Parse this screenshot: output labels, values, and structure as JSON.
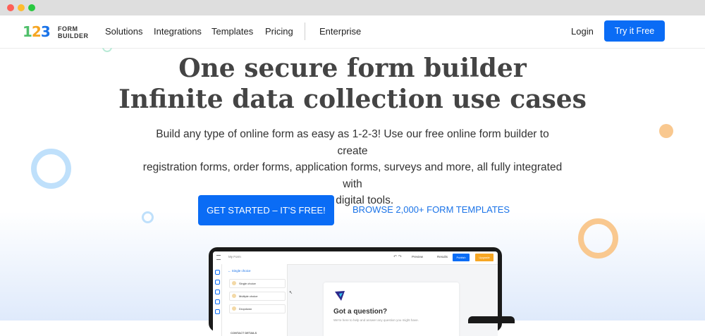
{
  "window": {
    "controls": [
      "close",
      "minimize",
      "zoom"
    ]
  },
  "logo": {
    "nums": [
      "1",
      "2",
      "3"
    ],
    "line1": "FORM",
    "line2": "BUILDER"
  },
  "nav": {
    "items": [
      "Solutions",
      "Integrations",
      "Templates",
      "Pricing"
    ],
    "enterprise": "Enterprise",
    "login": "Login",
    "cta": "Try it Free"
  },
  "hero": {
    "title_line1": "One secure form builder",
    "title_line2": "Infinite data collection use cases",
    "subtitle_line1": "Build any type of online form as easy as 1-2-3! Use our free online form builder to create",
    "subtitle_line2": "registration forms, order forms, application forms, surveys and more, all fully integrated with",
    "subtitle_line3": "your digital tools.",
    "cta_primary": "GET STARTED – IT'S FREE!",
    "cta_secondary": "BROWSE 2,000+ FORM TEMPLATES"
  },
  "mockup": {
    "form_name": "My Form",
    "toolbar": {
      "undo": "↶ ↷",
      "preview": "Preview",
      "results": "Results",
      "publish": "Publish",
      "upgrade": "Upgrade"
    },
    "panel": {
      "back_label": "Single choice",
      "items": [
        "Single choice",
        "Multiple choice",
        "Dropdown"
      ],
      "section": "CONTACT DETAILS"
    },
    "form": {
      "question": "Got a question?",
      "description": "We're here to help and answer any question you might have."
    }
  },
  "colors": {
    "primary": "#0a6cf5",
    "heading": "#444444",
    "logo_green": "#4fbf6a",
    "logo_orange": "#f6a623",
    "logo_blue": "#1a73e8",
    "deco_blue": "#bfe0fb",
    "deco_orange": "#f9c88f"
  }
}
